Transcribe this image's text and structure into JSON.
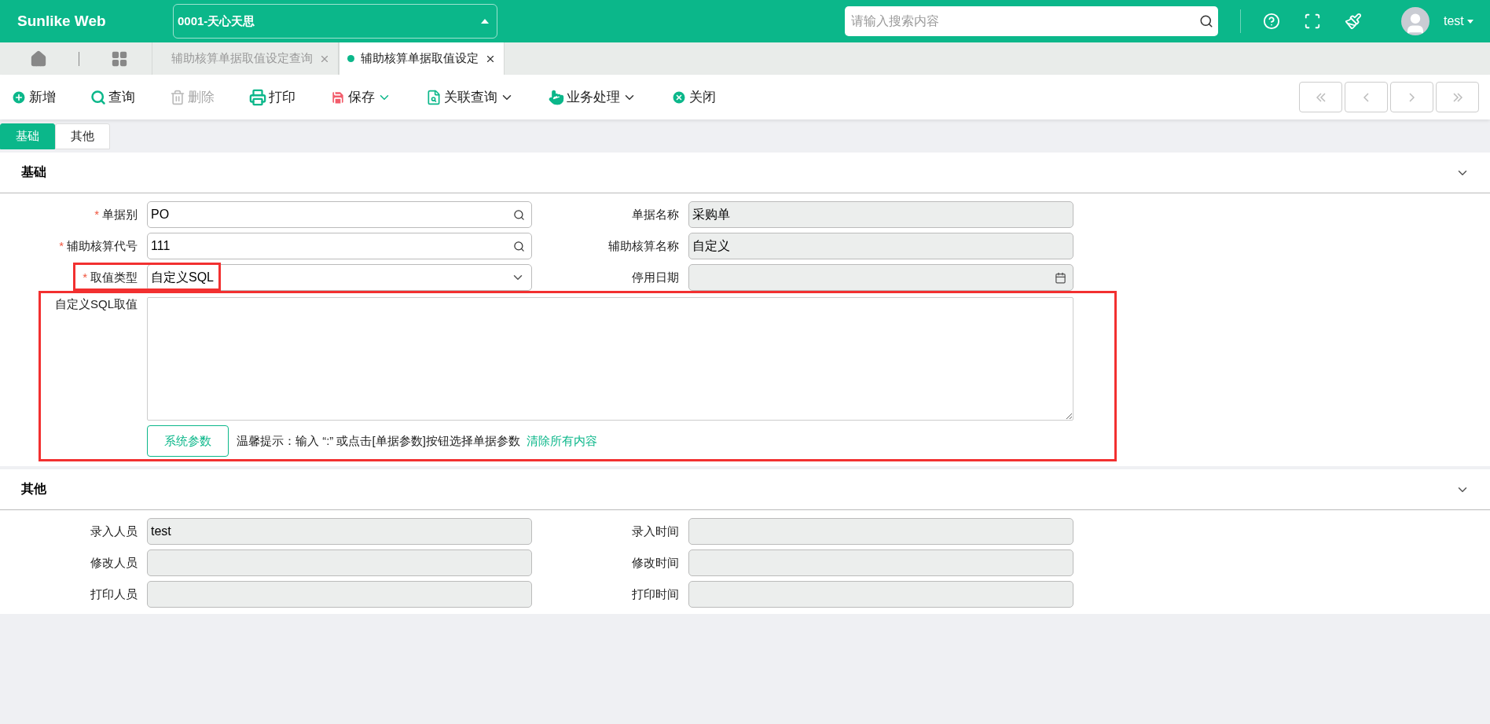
{
  "header": {
    "logo": "Sunlike Web",
    "company": "0001-天心天思",
    "search": {
      "placeholder": "请输入搜索内容"
    },
    "user": "test"
  },
  "page_tabs": [
    {
      "label": "辅助核算单据取值设定查询",
      "selected": false
    },
    {
      "label": "辅助核算单据取值设定",
      "selected": true
    }
  ],
  "toolbar": [
    {
      "kind": "add",
      "label": "新增",
      "disabled": false,
      "menu": false
    },
    {
      "kind": "query",
      "label": "查询",
      "disabled": false,
      "menu": false
    },
    {
      "kind": "delete",
      "label": "删除",
      "disabled": true,
      "menu": false
    },
    {
      "kind": "print",
      "label": "打印",
      "disabled": false,
      "menu": false
    },
    {
      "kind": "save",
      "label": "保存",
      "disabled": false,
      "menu": true
    },
    {
      "kind": "related",
      "label": "关联查询",
      "disabled": false,
      "menu": true
    },
    {
      "kind": "business",
      "label": "业务处理",
      "disabled": false,
      "menu": true
    },
    {
      "kind": "close",
      "label": "关闭",
      "disabled": false,
      "menu": false
    }
  ],
  "form_tabs": [
    {
      "label": "基础",
      "selected": true
    },
    {
      "label": "其他",
      "selected": false
    }
  ],
  "sections": [
    {
      "title": "基础",
      "rows": [
        [
          {
            "required_mark": "*",
            "label": "单据别",
            "kind": "lookup",
            "value": "PO"
          },
          {
            "label": "单据名称",
            "kind": "readonly",
            "value": "采购单"
          }
        ],
        [
          {
            "required_mark": "*",
            "label": "辅助核算代号",
            "kind": "lookup",
            "value": "111"
          },
          {
            "label": "辅助核算名称",
            "kind": "readonly",
            "value": "自定义"
          }
        ],
        [
          {
            "required_mark": "*",
            "label": "取值类型",
            "kind": "select",
            "value": "自定义SQL",
            "highlighted": true
          },
          {
            "label": "停用日期",
            "kind": "date"
          }
        ]
      ],
      "sql": {
        "label": "自定义SQL取值",
        "button": "系统参数",
        "hint": "温馨提示：输入 “:” 或点击[单据参数]按钮选择单据参数",
        "link": "清除所有内容",
        "highlighted": true
      }
    },
    {
      "title": "其他",
      "rows": [
        [
          {
            "label": "录入人员",
            "kind": "readonly",
            "value": "test"
          },
          {
            "label": "录入时间",
            "kind": "readonly"
          }
        ],
        [
          {
            "label": "修改人员",
            "kind": "readonly"
          },
          {
            "label": "修改时间",
            "kind": "readonly"
          }
        ],
        [
          {
            "label": "打印人员",
            "kind": "readonly"
          },
          {
            "label": "打印时间",
            "kind": "readonly"
          }
        ]
      ]
    }
  ]
}
